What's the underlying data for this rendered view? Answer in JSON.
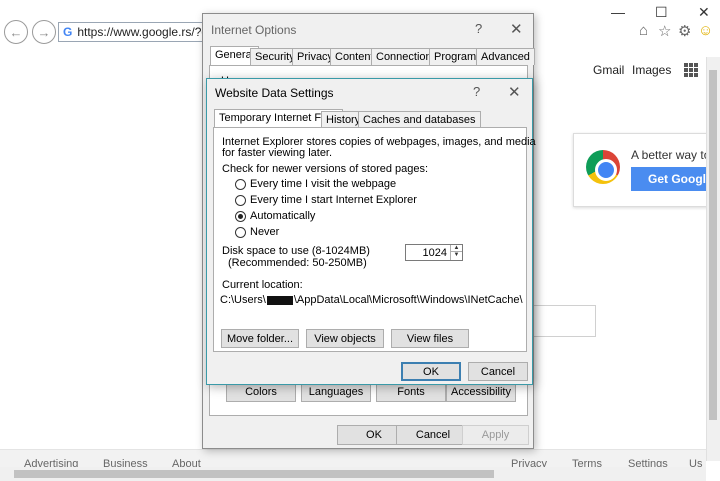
{
  "browser": {
    "address_url": "https://www.google.rs/?gws",
    "back_glyph": "←",
    "forward_glyph": "→",
    "google_g": "G",
    "window_controls": [
      "—",
      "☐",
      "✕"
    ],
    "toolbar_icons": [
      "home-icon",
      "star-icon",
      "gear-icon",
      "smiley-icon"
    ],
    "toolbar_glyphs": [
      "⌂",
      "☆",
      "⚙",
      "☺"
    ]
  },
  "page": {
    "top_links": [
      "Gmail",
      "Images"
    ],
    "promo_text": "A better way to",
    "promo_button": "Get Google",
    "footer_left": [
      "Advertising",
      "Business",
      "About"
    ],
    "footer_right": [
      "Privacy",
      "Terms",
      "Settings",
      "Us"
    ]
  },
  "internet_options": {
    "title": "Internet Options",
    "help": "?",
    "close": "✕",
    "tabs": [
      "General",
      "Security",
      "Privacy",
      "Content",
      "Connections",
      "Programs",
      "Advanced"
    ],
    "active_tab": "General",
    "home_page_label": "Home page",
    "appearance_buttons": [
      "Colors",
      "Languages",
      "Fonts",
      "Accessibility"
    ],
    "buttons": {
      "ok": "OK",
      "cancel": "Cancel",
      "apply": "Apply"
    }
  },
  "website_data_settings": {
    "title": "Website Data Settings",
    "help": "?",
    "close": "✕",
    "tabs": [
      "Temporary Internet Files",
      "History",
      "Caches and databases"
    ],
    "active_tab": "Temporary Internet Files",
    "description_line1": "Internet Explorer stores copies of webpages, images, and media",
    "description_line2": "for faster viewing later.",
    "check_label": "Check for newer versions of stored pages:",
    "options": [
      "Every time I visit the webpage",
      "Every time I start Internet Explorer",
      "Automatically",
      "Never"
    ],
    "selected_option": "Automatically",
    "disk_label": "Disk space to use (8-1024MB)",
    "disk_recommended": "(Recommended: 50-250MB)",
    "disk_value": "1024",
    "location_label": "Current location:",
    "location_prefix": "C:\\Users\\",
    "location_suffix": "\\AppData\\Local\\Microsoft\\Windows\\INetCache\\",
    "panel_buttons": {
      "move_folder": "Move folder...",
      "view_objects": "View objects",
      "view_files": "View files"
    },
    "buttons": {
      "ok": "OK",
      "cancel": "Cancel"
    }
  }
}
